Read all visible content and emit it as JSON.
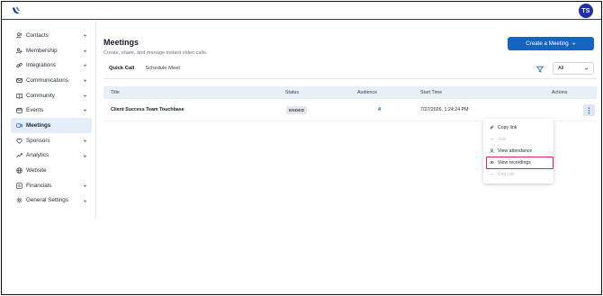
{
  "header": {
    "user_initials": "TS",
    "colors": {
      "accent": "#1565c0",
      "avatar": "#1e2fa8",
      "highlight": "#d6245c",
      "active_nav": "#e4ecf7"
    }
  },
  "sidebar": {
    "items": [
      {
        "label": "Contacts",
        "icon": "contacts-icon",
        "has_chevron": true
      },
      {
        "label": "Membership",
        "icon": "membership-icon",
        "has_chevron": true
      },
      {
        "label": "Integrations",
        "icon": "link-icon",
        "has_chevron": true
      },
      {
        "label": "Communications",
        "icon": "mail-icon",
        "has_chevron": true
      },
      {
        "label": "Community",
        "icon": "book-icon",
        "has_chevron": true
      },
      {
        "label": "Events",
        "icon": "calendar-icon",
        "has_chevron": true
      },
      {
        "label": "Meetings",
        "icon": "video-icon",
        "has_chevron": false,
        "active": true
      },
      {
        "label": "Sponsors",
        "icon": "sponsor-icon",
        "has_chevron": true
      },
      {
        "label": "Analytics",
        "icon": "analytics-icon",
        "has_chevron": true
      },
      {
        "label": "Website",
        "icon": "globe-icon",
        "has_chevron": false
      },
      {
        "label": "Financials",
        "icon": "financials-icon",
        "has_chevron": true
      },
      {
        "label": "General Settings",
        "icon": "gear-icon",
        "has_chevron": true
      }
    ]
  },
  "main": {
    "title": "Meetings",
    "subtitle": "Create, share, and manage instant video calls.",
    "create_button": "Create a Meeting",
    "tabs": [
      {
        "label": "Quick Call",
        "active": true
      },
      {
        "label": "Schedule Meet",
        "active": false
      }
    ],
    "filter": {
      "selected": "All"
    },
    "table": {
      "columns": [
        "Title",
        "Status",
        "Audience",
        "Start Time",
        "Actions"
      ],
      "rows": [
        {
          "title": "Client Success Team Touchbase",
          "status": "ENDED",
          "audience": "4",
          "start_time": "7/27/2026, 1:24:24 PM"
        }
      ]
    },
    "action_menu": {
      "items": [
        {
          "label": "Copy link",
          "icon": "copy-icon",
          "disabled": false
        },
        {
          "label": "Join",
          "icon": "join-icon",
          "disabled": true
        },
        {
          "label": "View attendance",
          "icon": "attendance-icon",
          "disabled": false
        },
        {
          "label": "View recordings",
          "icon": "recording-icon",
          "disabled": false,
          "highlighted": true
        },
        {
          "label": "End call",
          "icon": "end-call-icon",
          "disabled": true
        }
      ]
    }
  }
}
